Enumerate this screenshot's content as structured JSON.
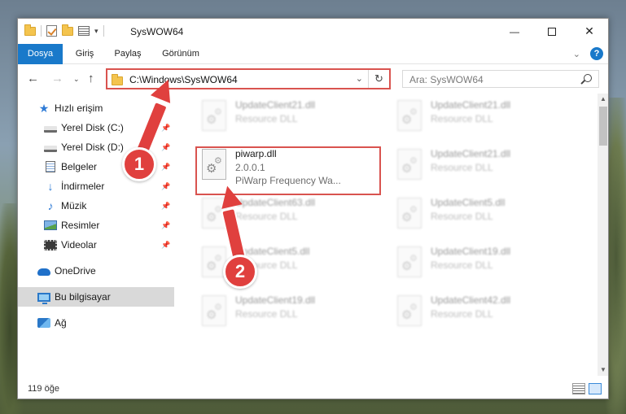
{
  "window": {
    "title": "SysWOW64",
    "controls": {
      "minimize": "—",
      "maximize": "",
      "close": "✕"
    }
  },
  "ribbon": {
    "tabs": [
      "Dosya",
      "Giriş",
      "Paylaş",
      "Görünüm"
    ],
    "collapse_icon": "chevron-down-icon",
    "help_label": "?"
  },
  "address": {
    "path": "C:\\Windows\\SysWOW64",
    "search_placeholder": "Ara: SysWOW64"
  },
  "nav_pane": {
    "items": [
      {
        "label": "Hızlı erişim",
        "icon": "star-icon",
        "pinned": false
      },
      {
        "label": "Yerel Disk (C:)",
        "icon": "drive-icon",
        "pinned": true
      },
      {
        "label": "Yerel Disk (D:)",
        "icon": "drive-icon",
        "pinned": true
      },
      {
        "label": "Belgeler",
        "icon": "documents-icon",
        "pinned": true
      },
      {
        "label": "İndirmeler",
        "icon": "download-icon",
        "pinned": true
      },
      {
        "label": "Müzik",
        "icon": "music-icon",
        "pinned": true
      },
      {
        "label": "Resimler",
        "icon": "pictures-icon",
        "pinned": true
      },
      {
        "label": "Videolar",
        "icon": "videos-icon",
        "pinned": true
      },
      {
        "label": "OneDrive",
        "icon": "onedrive-icon",
        "pinned": false
      },
      {
        "label": "Bu bilgisayar",
        "icon": "computer-icon",
        "pinned": false,
        "selected": true
      },
      {
        "label": "Ağ",
        "icon": "network-icon",
        "pinned": false
      }
    ]
  },
  "files": {
    "focused": {
      "name": "piwarp.dll",
      "version": "2.0.0.1",
      "description": "PiWarp Frequency Wa..."
    },
    "background": [
      {
        "name": "UpdateClient21.dll",
        "type": "Resource DLL"
      },
      {
        "name": "UpdateClient21.dll",
        "type": "Resource DLL"
      },
      {
        "name": "UpdateClient21.dll",
        "type": "Resource DLL"
      },
      {
        "name": "UpdateClient63.dll",
        "type": "Resource DLL"
      },
      {
        "name": "UpdateClient5.dll",
        "type": "Resource DLL"
      },
      {
        "name": "UpdateClient5.dll",
        "type": "Resource DLL"
      },
      {
        "name": "UpdateClient19.dll",
        "type": "Resource DLL"
      },
      {
        "name": "UpdateClient19.dll",
        "type": "Resource DLL"
      },
      {
        "name": "UpdateClient42.dll",
        "type": "Resource DLL"
      }
    ]
  },
  "status": {
    "count": "119 öğe"
  },
  "annotations": {
    "step1": "1",
    "step2": "2",
    "color": "#e0403e"
  }
}
